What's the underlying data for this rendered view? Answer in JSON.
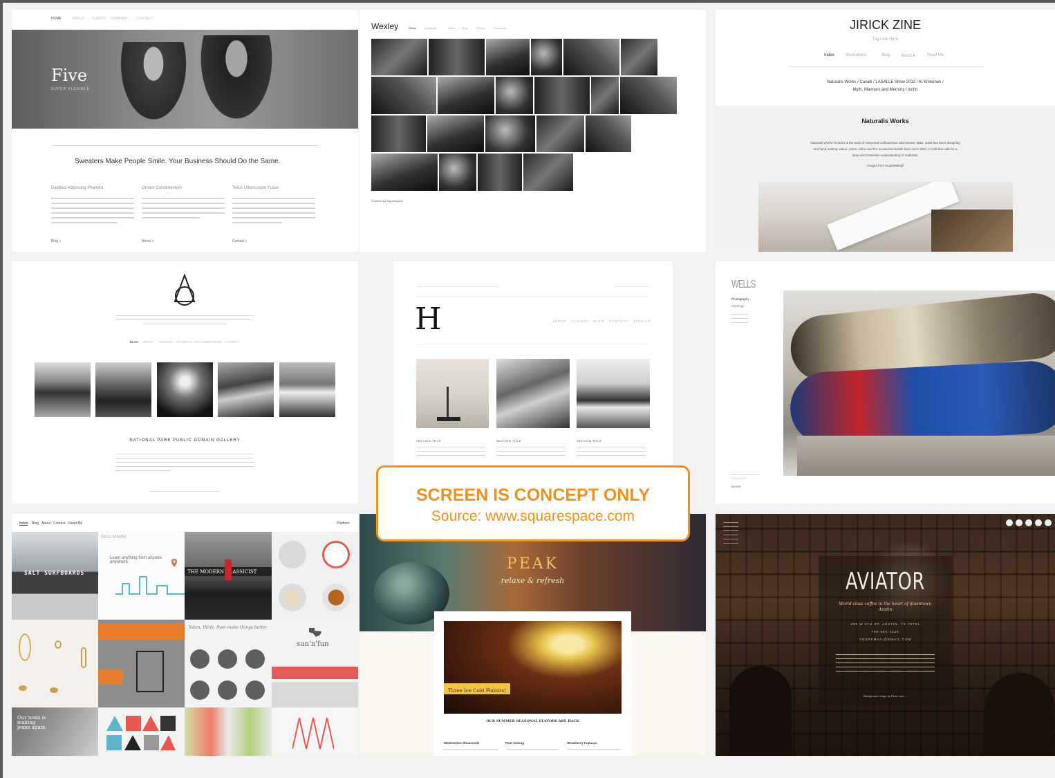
{
  "card_five": {
    "nav": [
      "HOME",
      "ABOUT",
      "CLIENTS",
      "COMPANY",
      "CONTACT"
    ],
    "logo": "Five",
    "tagline": "SUPER FLEXIBLE",
    "headline": "Sweaters Make People Smile. Your Business Should Do the Same.",
    "columns": [
      {
        "title": "Dapibus Adipiscing Pharetra",
        "link": "Blog »"
      },
      {
        "title": "Ornare Condimentum",
        "link": "About »"
      },
      {
        "title": "Tellus Ullamcorper Fusce",
        "link": "Contact »"
      }
    ]
  },
  "card_wexley": {
    "logo": "Wexley",
    "nav": [
      "Street",
      "Weddings",
      "About",
      "Blog",
      "Contact",
      "Purchase"
    ],
    "footer": "Powered by Squarespace"
  },
  "card_jirick": {
    "title": "JIRICK ZINE",
    "tagline": "Tag Line Here",
    "nav": [
      "Index",
      "Illustrations",
      "Blog",
      "About ▾",
      "Read Me"
    ],
    "links_line1": "Naturalis Works / Cavalli / LASALLE Show 2012 / Ki Kinnunen /",
    "links_line2": "Myth, Manners and Memory / kichn",
    "section_title": "Naturalis Works",
    "body_line1": "Naturalis Works #2 looks at the work of esteemed craftswoman Juliet Barker MBE. Juliet has been designing",
    "body_line2": "and hand-making violins, violas, cellos and the occasional double bass since 1994. A craft that calls for a",
    "body_line3": "deep and instinctive understanding of materials.",
    "credit": "Images from StudioMakgill"
  },
  "card_national": {
    "nav": [
      "BLOG",
      "ABOUT",
      "GALLERY",
      "PROJECTS",
      "COLLABORATIONS",
      "CONTACT"
    ],
    "caption": "NATIONAL PARK PUBLIC DOMAIN GALLERY"
  },
  "card_h": {
    "logo": "H",
    "nav": [
      "ABOUT",
      "CLIENTS",
      "BLOG",
      "CONTACT",
      "SIGN UP"
    ],
    "sections": [
      "SECTION TITLE",
      "SECTION TITLE",
      "SECTION TITLE"
    ]
  },
  "card_wells": {
    "logo": "WELLS",
    "nav": [
      "Photography",
      "Paintings"
    ],
    "caption": "BOXER"
  },
  "card_platform": {
    "nav": [
      "Index",
      "Blog",
      "About",
      "Contact",
      "Read Me"
    ],
    "brand": "Platform",
    "tile_salt": "SALT SURFBOARDS",
    "tile_skillshare": "SKILLSHARE",
    "tile_learn": "Learn anything from anyone, anywhere.",
    "tile_classicist": "THE MODERN CLASSICIST",
    "tile_sunfun": "sun'n'fun",
    "tile_town": "Our town is making jeans again.",
    "tile_script": "listen, think, then make things better"
  },
  "card_peak": {
    "title": "PEAK",
    "subtitle": "relaxe & refresh",
    "badge": "Three Ice Cold Flavors!",
    "headline": "OUR SUMMER SEASONAL FLAVORS ARE BACK",
    "flavors": [
      "Watermelon-Chamomile",
      "Pear-Oolong",
      "Strawberry Cupuaçu"
    ]
  },
  "card_aviator": {
    "title": "AVIATOR",
    "tagline": "World class coffee in the heart of downtown Austin",
    "address": "203 W 6TH ST, AUSTIN, TX 78701",
    "phone": "789-555-2345",
    "email": "YOUREMAIL@GMAIL.COM",
    "credit": "Background Image by Flickr user ..."
  },
  "overlay": {
    "title": "SCREEN IS CONCEPT ONLY",
    "source": "Source: www.squarespace.com",
    "accent": "#f0911e"
  }
}
